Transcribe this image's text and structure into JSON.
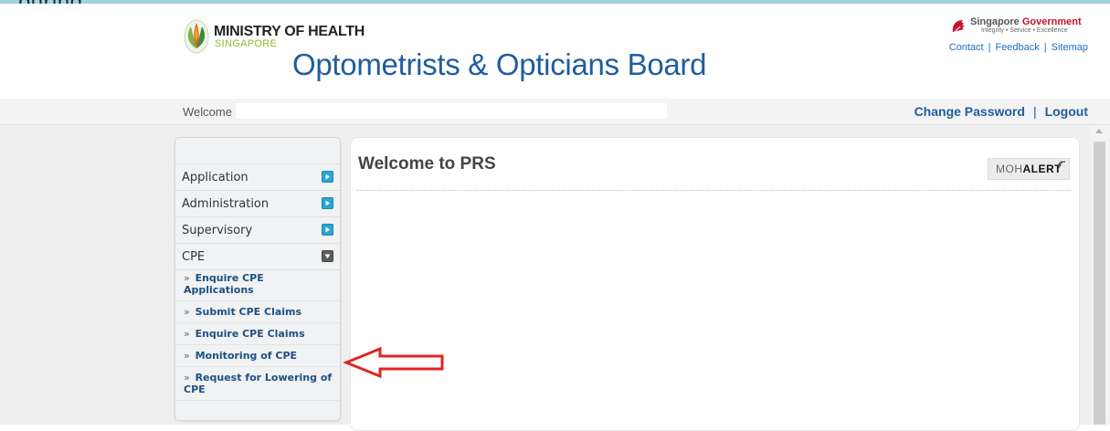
{
  "partial_caption": "ouring",
  "header": {
    "ministry_name": "MINISTRY OF HEALTH",
    "ministry_country": "SINGAPORE",
    "board_title": "Optometrists & Opticians Board",
    "gov_name_prefix": "Singapore",
    "gov_name_suffix": "Government",
    "gov_motto": "Integrity • Service • Excellence",
    "links": [
      {
        "label": "Contact"
      },
      {
        "label": "Feedback"
      },
      {
        "label": "Sitemap"
      }
    ],
    "link_separator": "|"
  },
  "welcome_bar": {
    "welcome_label": "Welcome",
    "welcome_value": "",
    "change_password": "Change Password",
    "separator": "|",
    "logout": "Logout"
  },
  "sidebar": {
    "menu": [
      {
        "label": "Application",
        "state": "collapsed"
      },
      {
        "label": "Administration",
        "state": "collapsed"
      },
      {
        "label": "Supervisory",
        "state": "collapsed"
      },
      {
        "label": "CPE",
        "state": "expanded"
      }
    ],
    "bullet": "»",
    "submenu": [
      {
        "label": "Enquire CPE Applications"
      },
      {
        "label": "Submit CPE Claims"
      },
      {
        "label": "Enquire CPE Claims"
      },
      {
        "label": "Monitoring of CPE"
      },
      {
        "label": "Request for Lowering of CPE"
      }
    ]
  },
  "main": {
    "title": "Welcome to PRS",
    "alert_prefix": "MOH",
    "alert_suffix": "ALERT"
  },
  "colors": {
    "brand_blue": "#1f5d9e",
    "link_blue": "#1f6fbf",
    "toggle_blue": "#29a5d6",
    "annotation_red": "#e02424",
    "moh_green": "#8dbb2c",
    "gov_red": "#c8102e"
  }
}
